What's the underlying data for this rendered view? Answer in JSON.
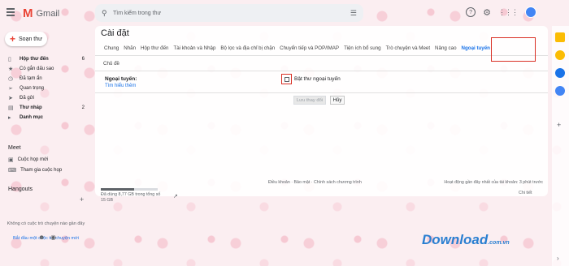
{
  "app": {
    "name": "Gmail"
  },
  "search": {
    "placeholder": "Tìm kiếm trong thư"
  },
  "header": {
    "help_icon": "?"
  },
  "compose": {
    "label": "Soạn thư"
  },
  "sidebar": {
    "items": [
      {
        "icon": "inbox-icon",
        "label": "Hộp thư đến",
        "count": "6",
        "bold": true
      },
      {
        "icon": "star-icon",
        "label": "Có gắn dấu sao",
        "count": ""
      },
      {
        "icon": "clock-icon",
        "label": "Đã tạm ẩn",
        "count": ""
      },
      {
        "icon": "important-icon",
        "label": "Quan trọng",
        "count": ""
      },
      {
        "icon": "send-icon",
        "label": "Đã gửi",
        "count": ""
      },
      {
        "icon": "draft-icon",
        "label": "Thư nháp",
        "count": "2",
        "bold": true
      },
      {
        "icon": "expand-icon",
        "label": "Danh mục",
        "count": "",
        "bold": true
      }
    ],
    "meet": {
      "title": "Meet",
      "new_meeting": "Cuộc họp mới",
      "join_meeting": "Tham gia cuộc họp"
    },
    "hangouts": {
      "title": "Hangouts",
      "empty_text": "Không có cuộc trò chuyện nào gần đây",
      "start_link": "Bắt đầu một cuộc trò chuyện mới"
    }
  },
  "settings": {
    "title": "Cài đặt",
    "tabs": [
      "Chung",
      "Nhãn",
      "Hộp thư đến",
      "Tài khoản và Nhập",
      "Bộ lọc và địa chỉ bị chặn",
      "Chuyển tiếp và POP/IMAP",
      "Tiện ích bổ sung",
      "Trò chuyện và Meet",
      "Nâng cao",
      "Ngoại tuyến"
    ],
    "active_tab": "Ngoại tuyến",
    "subtab": "Chủ đề",
    "offline_label": "Ngoại tuyến:",
    "learn_more": "Tìm hiểu thêm",
    "checkbox_label": "Bật thư ngoại tuyến",
    "checkbox_checked": false,
    "save_button": "Lưu thay đổi",
    "cancel_button": "Hủy"
  },
  "footer": {
    "storage": "Đã dùng 8,77 GB trong tổng số 15 GB",
    "storage_fraction": 0.58,
    "links": "Điều khoản · Bảo mật · Chính sách chương trình",
    "activity": "Hoạt động gần đây nhất của tài khoản: 3 phút trước",
    "details": "Chi tiết"
  },
  "watermark": {
    "text": "Download",
    "suffix": ".com.vn"
  },
  "colors": {
    "accent": "#1a73e8",
    "highlight": "#d93025"
  }
}
